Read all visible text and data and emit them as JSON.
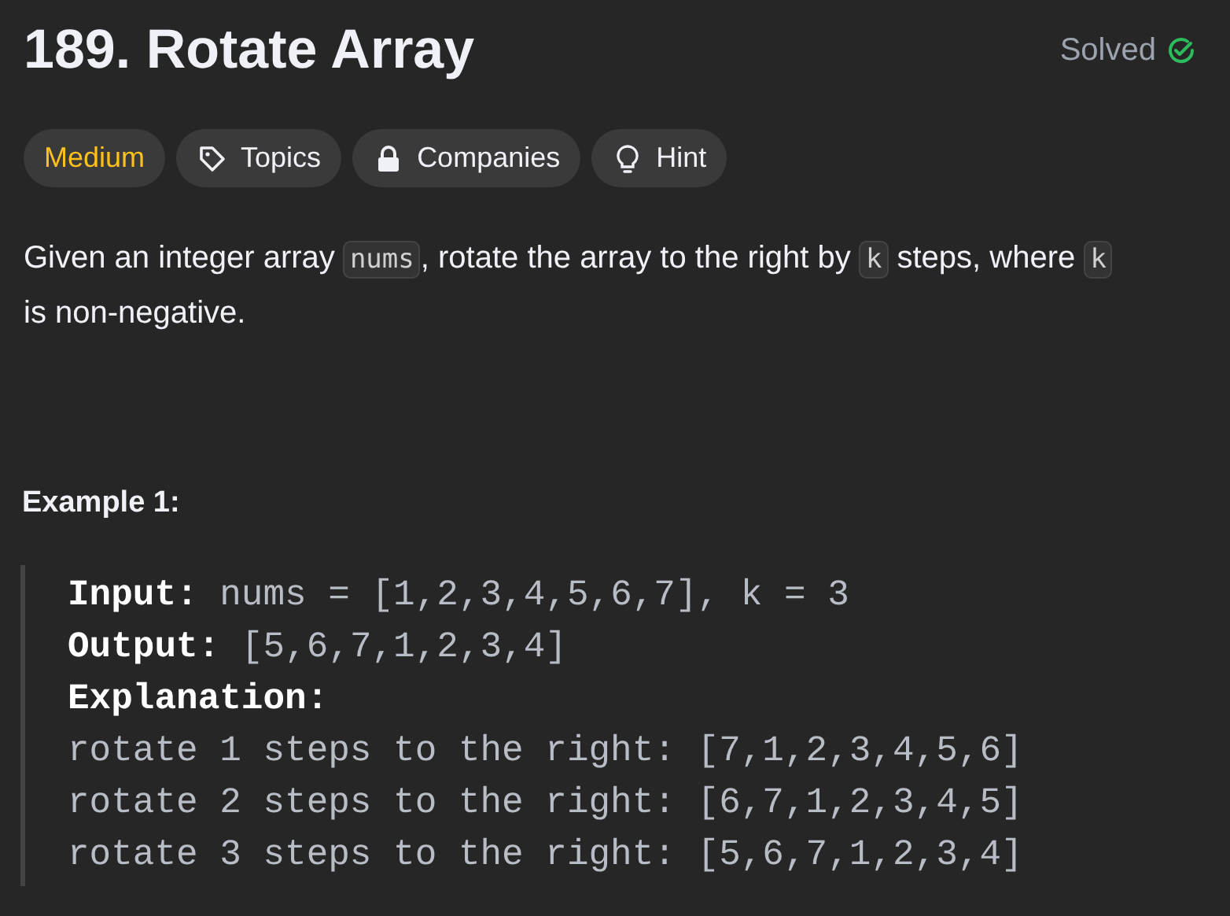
{
  "title": "189. Rotate Array",
  "status": {
    "label": "Solved",
    "solved": true
  },
  "tags": [
    {
      "kind": "difficulty",
      "label": "Medium",
      "color": "#ffc01e"
    },
    {
      "kind": "topics",
      "label": "Topics"
    },
    {
      "kind": "companies",
      "label": "Companies"
    },
    {
      "kind": "hint",
      "label": "Hint"
    }
  ],
  "description": [
    {
      "kind": "text",
      "text": "Given an integer array "
    },
    {
      "kind": "code",
      "text": "nums"
    },
    {
      "kind": "text",
      "text": ", rotate the array to the right by "
    },
    {
      "kind": "code",
      "text": "k"
    },
    {
      "kind": "text",
      "text": " steps, where "
    },
    {
      "kind": "code",
      "text": "k"
    },
    {
      "kind": "text",
      "text": " is non-negative."
    }
  ],
  "examples": [
    {
      "title": "Example 1:",
      "lines": [
        "**Input:** nums = [1,2,3,4,5,6,7], k = 3",
        "**Output:** [5,6,7,1,2,3,4]",
        "**Explanation:**",
        "rotate 1 steps to the right: [7,1,2,3,4,5,6]",
        "rotate 2 steps to the right: [6,7,1,2,3,4,5]",
        "rotate 3 steps to the right: [5,6,7,1,2,3,4]"
      ]
    }
  ]
}
